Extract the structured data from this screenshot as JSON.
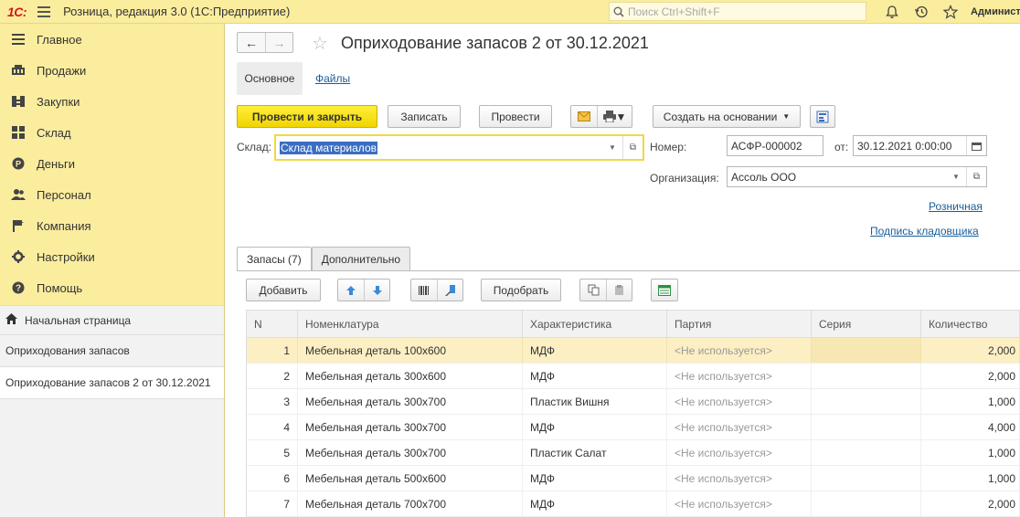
{
  "topbar": {
    "logo": "1С:",
    "app_title": "Розница, редакция 3.0  (1С:Предприятие)",
    "search_placeholder": "Поиск Ctrl+Shift+F",
    "user": "Администр"
  },
  "sidebar": {
    "items": [
      {
        "label": "Главное",
        "icon": "menu-icon"
      },
      {
        "label": "Продажи",
        "icon": "cart-icon"
      },
      {
        "label": "Закупки",
        "icon": "purchase-icon"
      },
      {
        "label": "Склад",
        "icon": "warehouse-icon"
      },
      {
        "label": "Деньги",
        "icon": "money-icon"
      },
      {
        "label": "Персонал",
        "icon": "people-icon"
      },
      {
        "label": "Компания",
        "icon": "flag-icon"
      },
      {
        "label": "Настройки",
        "icon": "gear-icon"
      },
      {
        "label": "Помощь",
        "icon": "help-icon"
      }
    ],
    "home": "Начальная страница",
    "open_windows": [
      "Оприходования запасов",
      "Оприходование запасов 2 от 30.12.2021"
    ]
  },
  "document": {
    "title": "Оприходование запасов 2 от 30.12.2021",
    "tabs": {
      "main": "Основное",
      "files": "Файлы"
    },
    "toolbar": {
      "post_close": "Провести и закрыть",
      "write": "Записать",
      "post": "Провести",
      "create_based": "Создать на основании"
    },
    "fields": {
      "warehouse_label": "Склад:",
      "warehouse_value": "Склад материалов",
      "number_label": "Номер:",
      "number_value": "АСФР-000002",
      "date_label": "от:",
      "date_value": "30.12.2021  0:00:00",
      "org_label": "Организация:",
      "org_value": "Ассоль ООО"
    },
    "links": {
      "retail": "Розничная",
      "storekeeper": "Подпись кладовщика"
    },
    "inner_tabs": [
      "Запасы (7)",
      "Дополнительно"
    ],
    "table_toolbar": {
      "add": "Добавить",
      "pick": "Подобрать"
    }
  },
  "table": {
    "columns": [
      "N",
      "Номенклатура",
      "Характеристика",
      "Партия",
      "Серия",
      "Количество"
    ],
    "rows": [
      {
        "n": "1",
        "nom": "Мебельная деталь 100х600",
        "char": "МДФ",
        "part": "<Не используется>",
        "ser": "",
        "qty": "2,000"
      },
      {
        "n": "2",
        "nom": "Мебельная деталь 300х600",
        "char": "МДФ",
        "part": "<Не используется>",
        "ser": "",
        "qty": "2,000"
      },
      {
        "n": "3",
        "nom": "Мебельная деталь 300х700",
        "char": "Пластик Вишня",
        "part": "<Не используется>",
        "ser": "",
        "qty": "1,000"
      },
      {
        "n": "4",
        "nom": "Мебельная деталь 300х700",
        "char": "МДФ",
        "part": "<Не используется>",
        "ser": "",
        "qty": "4,000"
      },
      {
        "n": "5",
        "nom": "Мебельная деталь 300х700",
        "char": "Пластик Салат",
        "part": "<Не используется>",
        "ser": "",
        "qty": "1,000"
      },
      {
        "n": "6",
        "nom": "Мебельная деталь 500х600",
        "char": "МДФ",
        "part": "<Не используется>",
        "ser": "",
        "qty": "1,000"
      },
      {
        "n": "7",
        "nom": "Мебельная деталь 700х700",
        "char": "МДФ",
        "part": "<Не используется>",
        "ser": "",
        "qty": "2,000"
      }
    ]
  },
  "colors": {
    "accent_yellow": "#fbed9e",
    "primary_button": "#f1d500",
    "link": "#1a5e9a",
    "logo_red": "#d6141b"
  }
}
